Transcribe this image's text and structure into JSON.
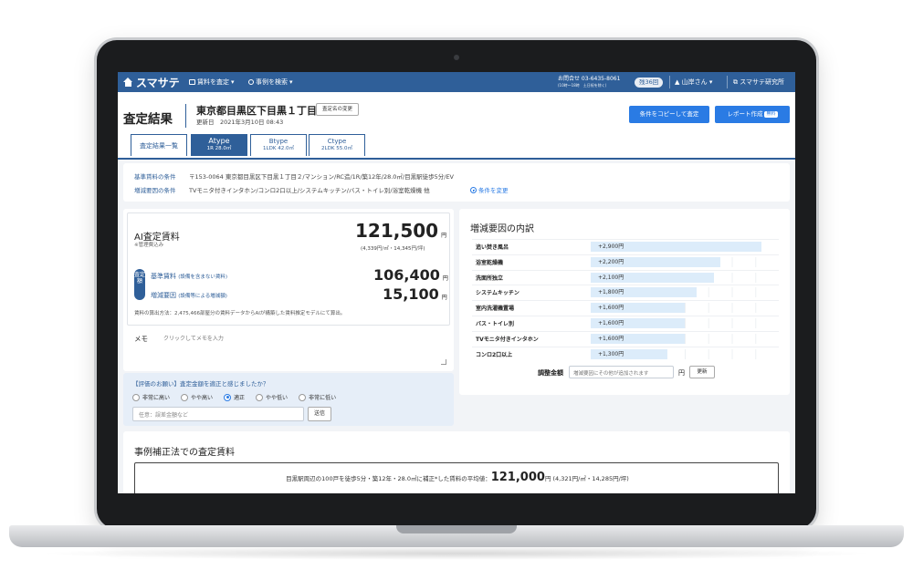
{
  "nav": {
    "logo": "スマサテ",
    "menu_rent": "賃料を査定",
    "menu_case": "事例を検索",
    "contact_line1": "お問合せ 03-6435-8061",
    "contact_line2": "(10時〜18時　土日祝を除く)",
    "remaining": "残36回",
    "user": "山岸さん",
    "lab": "スマサテ研究所"
  },
  "header": {
    "title": "査定結果",
    "address": "東京都目黒区下目黒１丁目２",
    "updated": "更新日　2021年3月10日 08:43",
    "rename_button": "査定名の変更",
    "copy_button": "条件をコピーして査定",
    "report_button": "レポート作成",
    "report_badge": "無料"
  },
  "tabs": [
    {
      "label": "査定結果一覧",
      "sub": ""
    },
    {
      "label": "Atype",
      "sub": "1R 28.0㎡"
    },
    {
      "label": "Btype",
      "sub": "1LDK 42.0㎡"
    },
    {
      "label": "Ctype",
      "sub": "2LDK 55.0㎡"
    }
  ],
  "conditions": {
    "base_label": "基準賃料の条件",
    "base_value": "〒153-0064 東京都目黒区下目黒１丁目２/マンション/RC造/1R/築12年/28.0㎡/目黒駅徒歩5分/EV",
    "factor_label": "増減要因の条件",
    "factor_value": "TVモニタ付きインタホン/コンロ2口以上/システムキッチン/バス・トイレ別/浴室乾燥機 他",
    "change_link": "条件を変更"
  },
  "ai": {
    "title": "AI査定賃料",
    "note": "※管理費込み",
    "price": "121,500",
    "yen": "円",
    "unit_price": "(4,339円/㎡・14,345円/坪)",
    "badge": "査定額",
    "base_label": "基準賃料",
    "base_paren": "(設備を含まない賃料)",
    "base_value": "106,400",
    "factor_label": "増減要因",
    "factor_paren": "(設備等による増減額)",
    "factor_value": "15,100",
    "calc_note": "賃料の算出方法：2,475,466部屋分の賃料データからAIが構築した賃料推定モデルにて算出。",
    "memo_label": "メモ",
    "memo_placeholder": "クリックしてメモを入力"
  },
  "feedback": {
    "question": "【評価のお願い】査定金額を適正と感じましたか？",
    "options": [
      "非常に高い",
      "やや高い",
      "適正",
      "やや低い",
      "非常に低い"
    ],
    "selected": 2,
    "input_placeholder": "任意：誤差金額など",
    "send": "送信"
  },
  "factors": {
    "title": "増減要因の内訳",
    "items": [
      {
        "label": "追い焚き風呂",
        "value": "+2,900円",
        "amount": 2900
      },
      {
        "label": "浴室乾燥機",
        "value": "+2,200円",
        "amount": 2200
      },
      {
        "label": "洗面所独立",
        "value": "+2,100円",
        "amount": 2100
      },
      {
        "label": "システムキッチン",
        "value": "+1,800円",
        "amount": 1800
      },
      {
        "label": "室内洗濯機置場",
        "value": "+1,600円",
        "amount": 1600
      },
      {
        "label": "バス・トイレ別",
        "value": "+1,600円",
        "amount": 1600
      },
      {
        "label": "TVモニタ付きインタホン",
        "value": "+1,600円",
        "amount": 1600
      },
      {
        "label": "コンロ2口以上",
        "value": "+1,300円",
        "amount": 1300
      }
    ],
    "adjust_label": "調整金額",
    "adjust_placeholder": "増減要因にその他が追加されます",
    "adjust_yen": "円",
    "update_button": "更新"
  },
  "case": {
    "title": "事例補正法での査定賃料",
    "text_before": "目黒駅周辺の100戸を徒歩5分・築12年・28.0㎡に補正*した賃料の平均値：",
    "price": "121,000",
    "yen": "円",
    "unit_price": "(4,321円/㎡・14,285円/坪)"
  },
  "colors": {
    "brand": "#2f5f99",
    "accent": "#2a7be4",
    "bar": "#dcecfa"
  }
}
